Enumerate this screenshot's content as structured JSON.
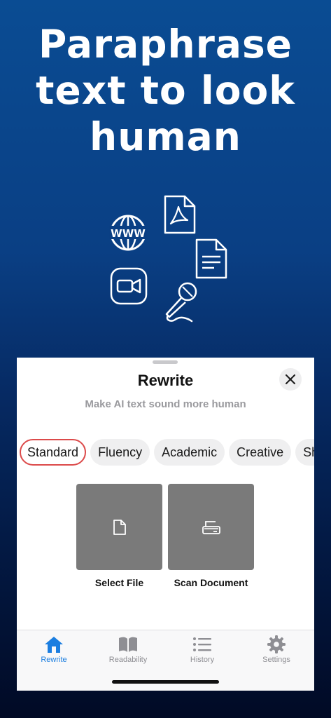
{
  "headline": {
    "line1": "Paraphrase",
    "line2": "text to look",
    "line3": "human"
  },
  "icons": {
    "web": "www-globe-icon",
    "pdf": "pdf-file-icon",
    "doc": "text-document-icon",
    "video": "video-camera-icon",
    "mic": "microphone-icon",
    "www_text": "WWW"
  },
  "sheet": {
    "title": "Rewrite",
    "subtitle": "Make AI text sound more human",
    "modes": [
      "Standard",
      "Fluency",
      "Academic",
      "Creative",
      "Short"
    ],
    "selected_mode": "Standard",
    "actions": [
      {
        "label": "Select File",
        "icon": "file-icon"
      },
      {
        "label": "Scan Document",
        "icon": "scanner-icon"
      }
    ]
  },
  "tabbar": {
    "tabs": [
      {
        "label": "Rewrite",
        "icon": "home-icon",
        "active": true
      },
      {
        "label": "Readability",
        "icon": "book-icon",
        "active": false
      },
      {
        "label": "History",
        "icon": "list-icon",
        "active": false
      },
      {
        "label": "Settings",
        "icon": "gear-icon",
        "active": false
      }
    ]
  },
  "colors": {
    "accent": "#1b7ee0",
    "selected_border": "#dc4a4a",
    "tile": "#7a7a7a"
  }
}
